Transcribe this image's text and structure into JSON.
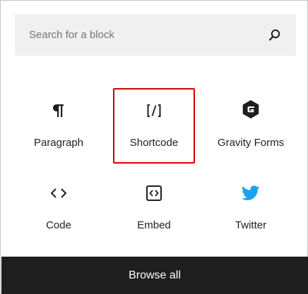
{
  "search": {
    "placeholder": "Search for a block",
    "icon": "search-icon"
  },
  "blocks": [
    {
      "label": "Paragraph",
      "icon": "paragraph-icon",
      "highlighted": false
    },
    {
      "label": "Shortcode",
      "icon": "shortcode-icon",
      "highlighted": true
    },
    {
      "label": "Gravity Forms",
      "icon": "gravity-forms-icon",
      "highlighted": false
    },
    {
      "label": "Code",
      "icon": "code-icon",
      "highlighted": false
    },
    {
      "label": "Embed",
      "icon": "embed-icon",
      "highlighted": false
    },
    {
      "label": "Twitter",
      "icon": "twitter-icon",
      "highlighted": false
    }
  ],
  "footer": {
    "browse_label": "Browse all"
  },
  "colors": {
    "highlight_border": "#d50000",
    "twitter_blue": "#1da1f2",
    "footer_bg": "#1e1e1e",
    "search_bg": "#f0f0f0"
  }
}
